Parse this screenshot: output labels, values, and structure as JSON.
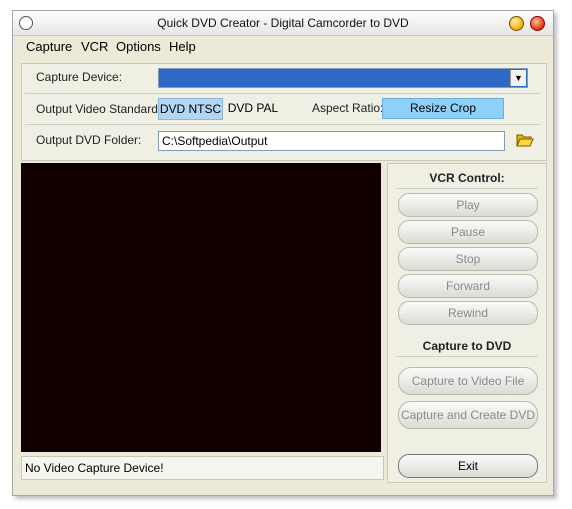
{
  "window": {
    "title": "Quick DVD Creator - Digital Camcorder to DVD"
  },
  "menu": {
    "items": [
      "Capture",
      "VCR",
      "Options",
      "Help"
    ]
  },
  "form": {
    "capture_device_label": "Capture Device:",
    "capture_device_value": "",
    "output_standard_label": "Output Video Standard:",
    "standard_ntsc": "DVD NTSC",
    "standard_pal": "DVD PAL",
    "aspect_ratio_label": "Aspect Ratio:",
    "aspect_ratio_value": "Resize Crop",
    "output_folder_label": "Output DVD Folder:",
    "output_folder_value": "C:\\Softpedia\\Output"
  },
  "status": {
    "text": "No Video Capture Device!"
  },
  "vcr": {
    "heading": "VCR Control:",
    "play": "Play",
    "pause": "Pause",
    "stop": "Stop",
    "forward": "Forward",
    "rewind": "Rewind"
  },
  "capture": {
    "heading": "Capture to DVD",
    "to_file": "Capture to Video File",
    "create_dvd": "Capture and Create DVD",
    "exit": "Exit"
  },
  "colors": {
    "selection": "#316ac5",
    "video_bg": "#100000",
    "resize_bg": "#8fd0fb"
  },
  "icons": [
    "folder-open-icon",
    "chevron-down-icon",
    "minimize-icon",
    "close-icon"
  ]
}
